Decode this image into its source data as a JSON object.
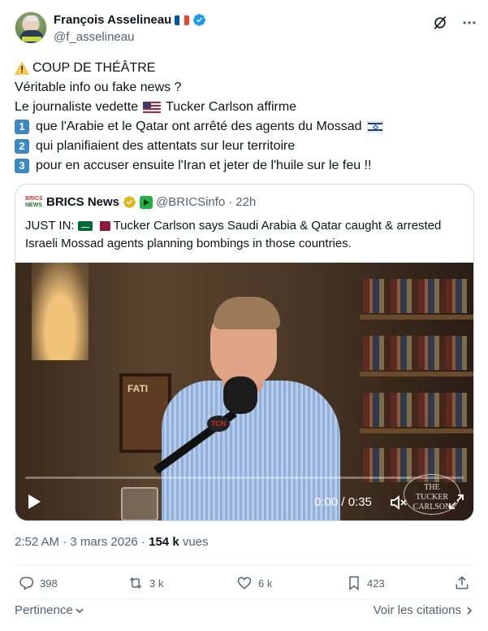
{
  "author": {
    "display_name": "François Asselineau",
    "handle": "@f_asselineau",
    "flag": "france-flag",
    "verified": true
  },
  "header_icons": [
    "grok-icon",
    "more-icon"
  ],
  "tweet": {
    "line1": "COUP DE THÉÂTRE",
    "line2": "Véritable info ou fake news ?",
    "line3_a": "Le journaliste vedette",
    "line3_b": "Tucker Carlson affirme",
    "keycap1": "1",
    "line4": "que l'Arabie et le Qatar ont arrêté des agents du Mossad",
    "keycap2": "2",
    "line5": "qui planifiaient des attentats sur leur territoire",
    "keycap3": "3",
    "line6": "pour en accuser ensuite l'Iran et jeter de l'huile sur le feu !!"
  },
  "quote": {
    "logo_line1": "BRICS",
    "logo_line2": "NEWS",
    "name": "BRICS News",
    "handle": "@BRICSinfo",
    "separator": "·",
    "time": "22h",
    "text_prefix": "JUST IN:",
    "text_a": "Tucker Carlson says Saudi Arabia & Qatar caught & arrested",
    "text_b": "Israeli Mossad agents planning bombings in those countries.",
    "video": {
      "time_display": "0:00 / 0:35",
      "progress": 0,
      "poster_text": "FATI",
      "mic_logo": "TCN",
      "watermark_line1": "THE",
      "watermark_line2": "TUCKER",
      "watermark_line3": "CARLSON"
    }
  },
  "meta": {
    "time": "2:52 AM",
    "dot1": "·",
    "date": "3 mars 2026",
    "dot2": "·",
    "views_count": "154 k",
    "views_label": "vues"
  },
  "actions": {
    "replies": "398",
    "reposts": "3 k",
    "likes": "6 k",
    "bookmarks": "423"
  },
  "footer": {
    "sort_label": "Pertinence",
    "quotes_link": "Voir les citations"
  },
  "colors": {
    "verified_blue": "#1d9bf0",
    "text": "#0f1419",
    "muted": "#536471",
    "border": "#cfd9de",
    "keycap_blue": "#3b88c3",
    "gold_badge": "#e2b719"
  }
}
